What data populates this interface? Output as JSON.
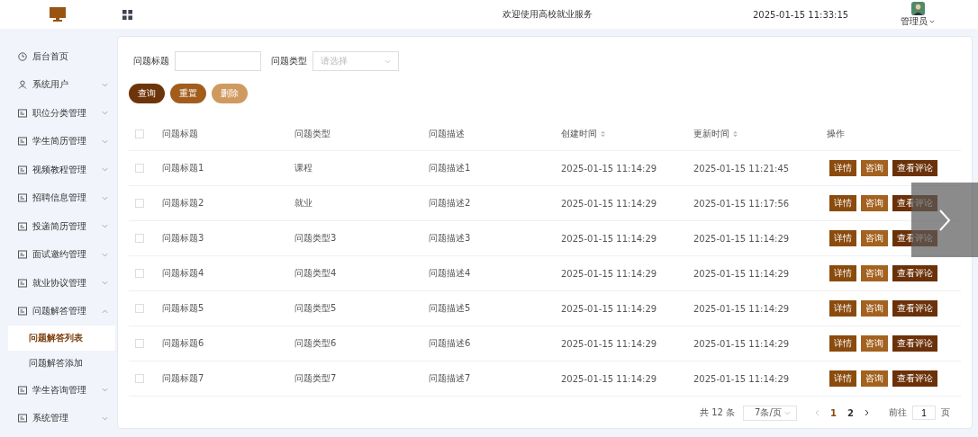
{
  "header": {
    "title": "欢迎使用高校就业服务",
    "datetime": "2025-01-15 11:33:15",
    "user": "管理员"
  },
  "sidebar": {
    "items": [
      {
        "label": "后台首页",
        "expandable": false
      },
      {
        "label": "系统用户",
        "expandable": true,
        "expanded": false
      },
      {
        "label": "职位分类管理",
        "expandable": true,
        "expanded": false
      },
      {
        "label": "学生简历管理",
        "expandable": true,
        "expanded": false
      },
      {
        "label": "视频教程管理",
        "expandable": true,
        "expanded": false
      },
      {
        "label": "招聘信息管理",
        "expandable": true,
        "expanded": false
      },
      {
        "label": "投递简历管理",
        "expandable": true,
        "expanded": false
      },
      {
        "label": "面试邀约管理",
        "expandable": true,
        "expanded": false
      },
      {
        "label": "就业协议管理",
        "expandable": true,
        "expanded": false
      },
      {
        "label": "问题解答管理",
        "expandable": true,
        "expanded": true,
        "children": [
          {
            "label": "问题解答列表",
            "selected": true
          },
          {
            "label": "问题解答添加",
            "selected": false
          }
        ]
      },
      {
        "label": "学生咨询管理",
        "expandable": true,
        "expanded": false
      },
      {
        "label": "系统管理",
        "expandable": true,
        "expanded": false
      }
    ]
  },
  "filters": {
    "title_label": "问题标题",
    "type_label": "问题类型",
    "type_placeholder": "请选择"
  },
  "buttons": [
    {
      "label": "查询",
      "color": "#6e3409"
    },
    {
      "label": "重置",
      "color": "#a25d1c"
    },
    {
      "label": "删除",
      "color": "#cf9a60"
    }
  ],
  "table": {
    "header_checked": false,
    "columns": [
      {
        "label": "问题标题",
        "sortable": false
      },
      {
        "label": "问题类型",
        "sortable": false
      },
      {
        "label": "问题描述",
        "sortable": false
      },
      {
        "label": "创建时间",
        "sortable": true
      },
      {
        "label": "更新时间",
        "sortable": true
      },
      {
        "label": "操作",
        "sortable": false
      }
    ],
    "rows": [
      {
        "checked": false,
        "cells": [
          "问题标题1",
          "课程",
          "问题描述1",
          "2025-01-15 11:14:29",
          "2025-01-15 11:21:45"
        ],
        "actions": [
          "详情",
          "咨询",
          "查看评论"
        ]
      },
      {
        "checked": false,
        "cells": [
          "问题标题2",
          "就业",
          "问题描述2",
          "2025-01-15 11:14:29",
          "2025-01-15 11:17:56"
        ],
        "actions": [
          "详情",
          "咨询",
          "查看评论"
        ]
      },
      {
        "checked": false,
        "cells": [
          "问题标题3",
          "问题类型3",
          "问题描述3",
          "2025-01-15 11:14:29",
          "2025-01-15 11:14:29"
        ],
        "actions": [
          "详情",
          "咨询",
          "查看评论"
        ]
      },
      {
        "checked": false,
        "cells": [
          "问题标题4",
          "问题类型4",
          "问题描述4",
          "2025-01-15 11:14:29",
          "2025-01-15 11:14:29"
        ],
        "actions": [
          "详情",
          "咨询",
          "查看评论"
        ]
      },
      {
        "checked": false,
        "cells": [
          "问题标题5",
          "问题类型5",
          "问题描述5",
          "2025-01-15 11:14:29",
          "2025-01-15 11:14:29"
        ],
        "actions": [
          "详情",
          "咨询",
          "查看评论"
        ]
      },
      {
        "checked": false,
        "cells": [
          "问题标题6",
          "问题类型6",
          "问题描述6",
          "2025-01-15 11:14:29",
          "2025-01-15 11:14:29"
        ],
        "actions": [
          "详情",
          "咨询",
          "查看评论"
        ]
      },
      {
        "checked": false,
        "cells": [
          "问题标题7",
          "问题类型7",
          "问题描述7",
          "2025-01-15 11:14:29",
          "2025-01-15 11:14:29"
        ],
        "actions": [
          "详情",
          "咨询",
          "查看评论"
        ]
      }
    ]
  },
  "pagination": {
    "total": "共 12 条",
    "page_size": "7条/页",
    "pages": [
      {
        "label": "1",
        "selected": true
      },
      {
        "label": "2",
        "selected": false
      }
    ],
    "goto_label": "前往",
    "goto_value": "1",
    "goto_suffix": "页"
  }
}
